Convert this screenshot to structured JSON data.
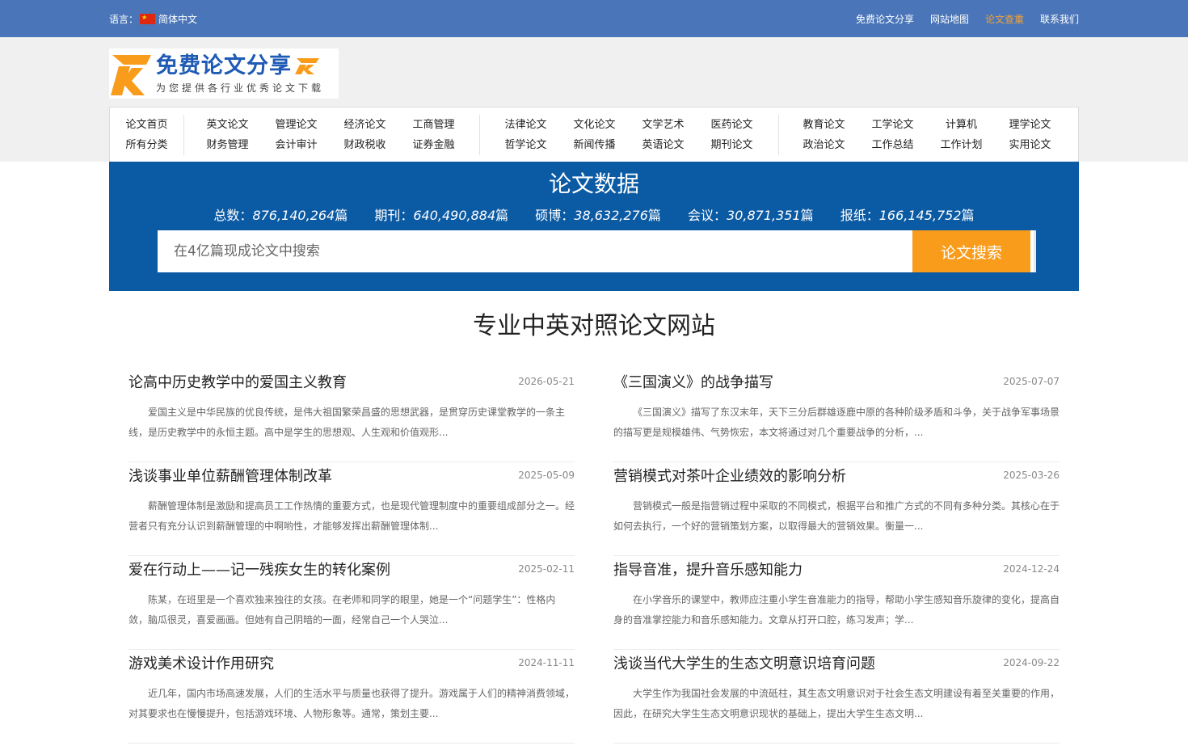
{
  "topbar": {
    "lang_label": "语言：",
    "lang_value": "简体中文",
    "links": [
      "免费论文分享",
      "网站地图",
      "论文查重",
      "联系我们"
    ],
    "active_link": "论文查重",
    "bg_color": "#4a76b9",
    "active_color": "#f7a12d"
  },
  "logo": {
    "title": "免费论文分享",
    "subtitle": "为您提供各行业优秀论文下载"
  },
  "nav": {
    "groups": [
      [
        "论文首页",
        "所有分类"
      ],
      [
        "英文论文",
        "财务管理",
        "管理论文",
        "会计审计",
        "经济论文",
        "财政税收",
        "工商管理",
        "证券金融"
      ],
      [
        "法律论文",
        "哲学论文",
        "文化论文",
        "新闻传播",
        "文学艺术",
        "英语论文",
        "医药论文",
        "期刊论文"
      ],
      [
        "教育论文",
        "政治论文",
        "工学论文",
        "工作总结",
        "计算机",
        "工作计划",
        "理学论文",
        "实用论文"
      ]
    ]
  },
  "data_panel": {
    "title": "论文数据",
    "stats": [
      {
        "label": "总数：",
        "value": "876,140,264",
        "unit": "篇"
      },
      {
        "label": "期刊：",
        "value": "640,490,884",
        "unit": "篇"
      },
      {
        "label": "硕博：",
        "value": "38,632,276",
        "unit": "篇"
      },
      {
        "label": "会议：",
        "value": "30,871,351",
        "unit": "篇"
      },
      {
        "label": "报纸：",
        "value": "166,145,752",
        "unit": "篇"
      }
    ],
    "bg_color": "#0b5aa4"
  },
  "search": {
    "placeholder": "在4亿篇现成论文中搜索",
    "value": "",
    "button_label": "论文搜索",
    "button_color": "#f99c1b"
  },
  "main": {
    "title": "专业中英对照论文网站",
    "articles": [
      {
        "title": "论高中历史教学中的爱国主义教育",
        "date": "2026-05-21",
        "excerpt": "爱国主义是中华民族的优良传统，是伟大祖国繁荣昌盛的思想武器，是贯穿历史课堂教学的一条主线，是历史教学中的永恒主题。高中是学生的思想观、人生观和价值观形..."
      },
      {
        "title": "《三国演义》的战争描写",
        "date": "2025-07-07",
        "excerpt": "《三国演义》描写了东汉末年，天下三分后群雄逐鹿中原的各种阶级矛盾和斗争，关于战争军事场景的描写更是规模雄伟、气势恢宏，本文将通过对几个重要战争的分析，..."
      },
      {
        "title": "浅谈事业单位薪酬管理体制改革",
        "date": "2025-05-09",
        "excerpt": "薪酬管理体制是激励和提高员工工作热情的重要方式，也是现代管理制度中的重要组成部分之一。经营者只有充分认识到薪酬管理的中啊哟性，才能够发挥出薪酬管理体制..."
      },
      {
        "title": "营销模式对茶叶企业绩效的影响分析",
        "date": "2025-03-26",
        "excerpt": "营销模式一般是指营销过程中采取的不同模式，根据平台和推广方式的不同有多种分类。其核心在于如何去执行，一个好的营销策划方案，以取得最大的营销效果。衡量一..."
      },
      {
        "title": "爱在行动上——记一残疾女生的转化案例",
        "date": "2025-02-11",
        "excerpt": "陈某，在班里是一个喜欢独来独往的女孩。在老师和同学的眼里，她是一个“问题学生”：性格内敛，脑瓜很灵，喜爱画画。但她有自己阴暗的一面，经常自己一个人哭泣..."
      },
      {
        "title": "指导音准，提升音乐感知能力",
        "date": "2024-12-24",
        "excerpt": "在小学音乐的课堂中，教师应注重小学生音准能力的指导，帮助小学生感知音乐旋律的变化，提高自身的音准掌控能力和音乐感知能力。文章从打开口腔，练习发声；学..."
      },
      {
        "title": "游戏美术设计作用研究",
        "date": "2024-11-11",
        "excerpt": "近几年，国内市场高速发展，人们的生活水平与质量也获得了提升。游戏属于人们的精神消费领域，对其要求也在慢慢提升，包括游戏环境、人物形象等。通常，策划主要..."
      },
      {
        "title": "浅谈当代大学生的生态文明意识培育问题",
        "date": "2024-09-22",
        "excerpt": "大学生作为我国社会发展的中流砥柱，其生态文明意识对于社会生态文明建设有着至关重要的作用，因此，在研究大学生生态文明意识现状的基础上，提出大学生生态文明..."
      }
    ]
  }
}
